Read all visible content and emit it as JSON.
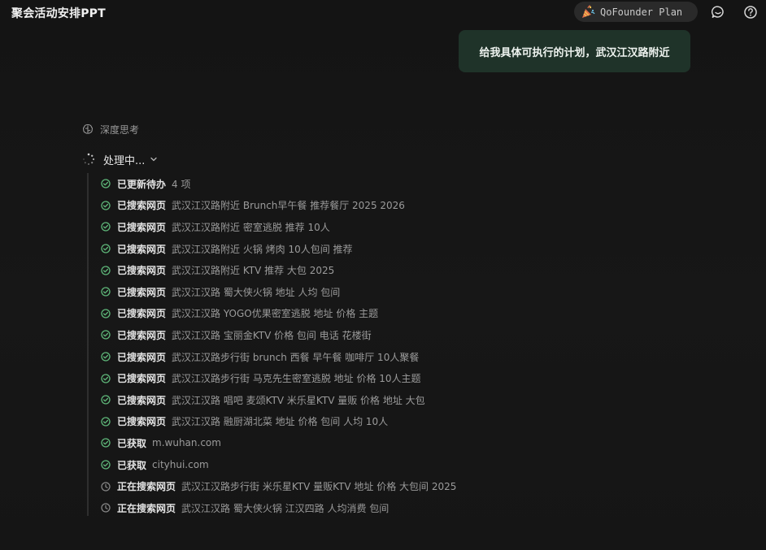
{
  "header": {
    "title": "聚会活动安排PPT",
    "plan_label": "QoFounder Plan",
    "plan_icon": "party-popper-icon",
    "actions": [
      {
        "icon": "chat-icon"
      },
      {
        "icon": "help-icon"
      }
    ]
  },
  "conversation": {
    "user_message": "给我具体可执行的计划，武汉江汉路附近"
  },
  "thinking": {
    "label": "深度思考",
    "icon": "brain-icon"
  },
  "processing": {
    "label": "处理中...",
    "icon": "spinner-icon",
    "chevron": "chevron-down-icon"
  },
  "colors": {
    "done": "#5fb87a",
    "pending": "#8a8a8a",
    "bubble": "#1f3329"
  },
  "steps": [
    {
      "state": "done",
      "status": "已更新待办",
      "detail": "4 项"
    },
    {
      "state": "done",
      "status": "已搜索网页",
      "detail": "武汉江汉路附近 Brunch早午餐 推荐餐厅 2025 2026"
    },
    {
      "state": "done",
      "status": "已搜索网页",
      "detail": "武汉江汉路附近 密室逃脱 推荐 10人"
    },
    {
      "state": "done",
      "status": "已搜索网页",
      "detail": "武汉江汉路附近 火锅 烤肉 10人包间 推荐"
    },
    {
      "state": "done",
      "status": "已搜索网页",
      "detail": "武汉江汉路附近 KTV 推荐 大包 2025"
    },
    {
      "state": "done",
      "status": "已搜索网页",
      "detail": "武汉江汉路 蜀大侠火锅 地址 人均 包间"
    },
    {
      "state": "done",
      "status": "已搜索网页",
      "detail": "武汉江汉路 YOGO优果密室逃脱 地址 价格 主题"
    },
    {
      "state": "done",
      "status": "已搜索网页",
      "detail": "武汉江汉路 宝丽金KTV 价格 包间 电话 花楼街"
    },
    {
      "state": "done",
      "status": "已搜索网页",
      "detail": "武汉江汉路步行街 brunch 西餐 早午餐 咖啡厅 10人聚餐"
    },
    {
      "state": "done",
      "status": "已搜索网页",
      "detail": "武汉江汉路步行街 马克先生密室逃脱 地址 价格 10人主题"
    },
    {
      "state": "done",
      "status": "已搜索网页",
      "detail": "武汉江汉路 唱吧 麦颂KTV 米乐星KTV 量贩 价格 地址 大包"
    },
    {
      "state": "done",
      "status": "已搜索网页",
      "detail": "武汉江汉路 融厨湖北菜 地址 价格 包间 人均 10人"
    },
    {
      "state": "done",
      "status": "已获取",
      "detail": "m.wuhan.com"
    },
    {
      "state": "done",
      "status": "已获取",
      "detail": "cityhui.com"
    },
    {
      "state": "pending",
      "status": "正在搜索网页",
      "detail": "武汉江汉路步行街 米乐星KTV 量贩KTV 地址 价格 大包间 2025"
    },
    {
      "state": "pending",
      "status": "正在搜索网页",
      "detail": "武汉江汉路 蜀大侠火锅 江汉四路 人均消费 包间"
    }
  ]
}
